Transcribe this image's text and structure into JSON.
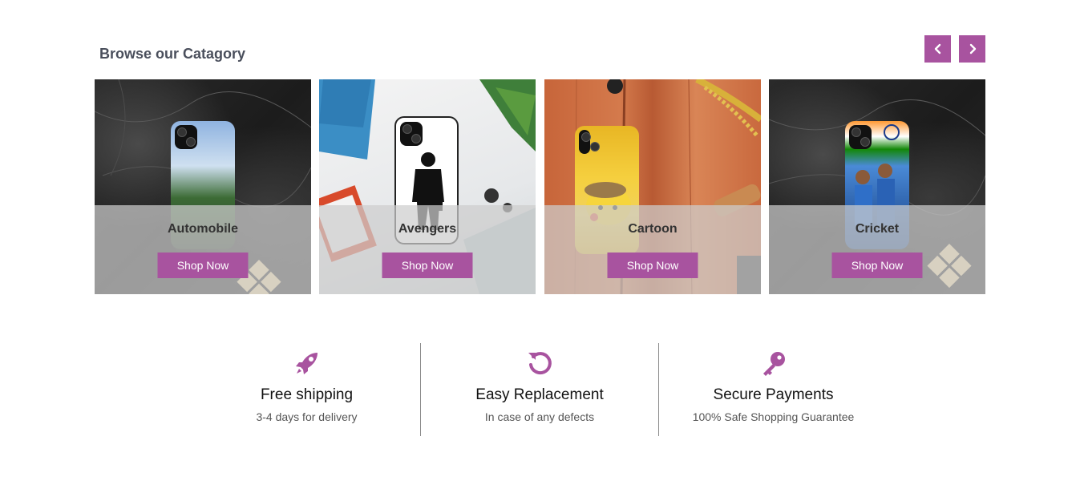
{
  "section": {
    "title": "Browse our Catagory"
  },
  "nav": {
    "prev_icon": "chevron-left-icon",
    "next_icon": "chevron-right-icon"
  },
  "categories": [
    {
      "label": "Automobile",
      "button": "Shop Now"
    },
    {
      "label": "Avengers",
      "button": "Shop Now"
    },
    {
      "label": "Cartoon",
      "button": "Shop Now"
    },
    {
      "label": "Cricket",
      "button": "Shop Now"
    }
  ],
  "features": [
    {
      "icon": "rocket-icon",
      "title": "Free shipping",
      "subtitle": "3-4 days for delivery"
    },
    {
      "icon": "refresh-icon",
      "title": "Easy Replacement",
      "subtitle": "In case of any defects"
    },
    {
      "icon": "key-icon",
      "title": "Secure Payments",
      "subtitle": "100% Safe Shopping Guarantee"
    }
  ],
  "colors": {
    "accent": "#a8539f",
    "title": "#4a4f5c"
  }
}
